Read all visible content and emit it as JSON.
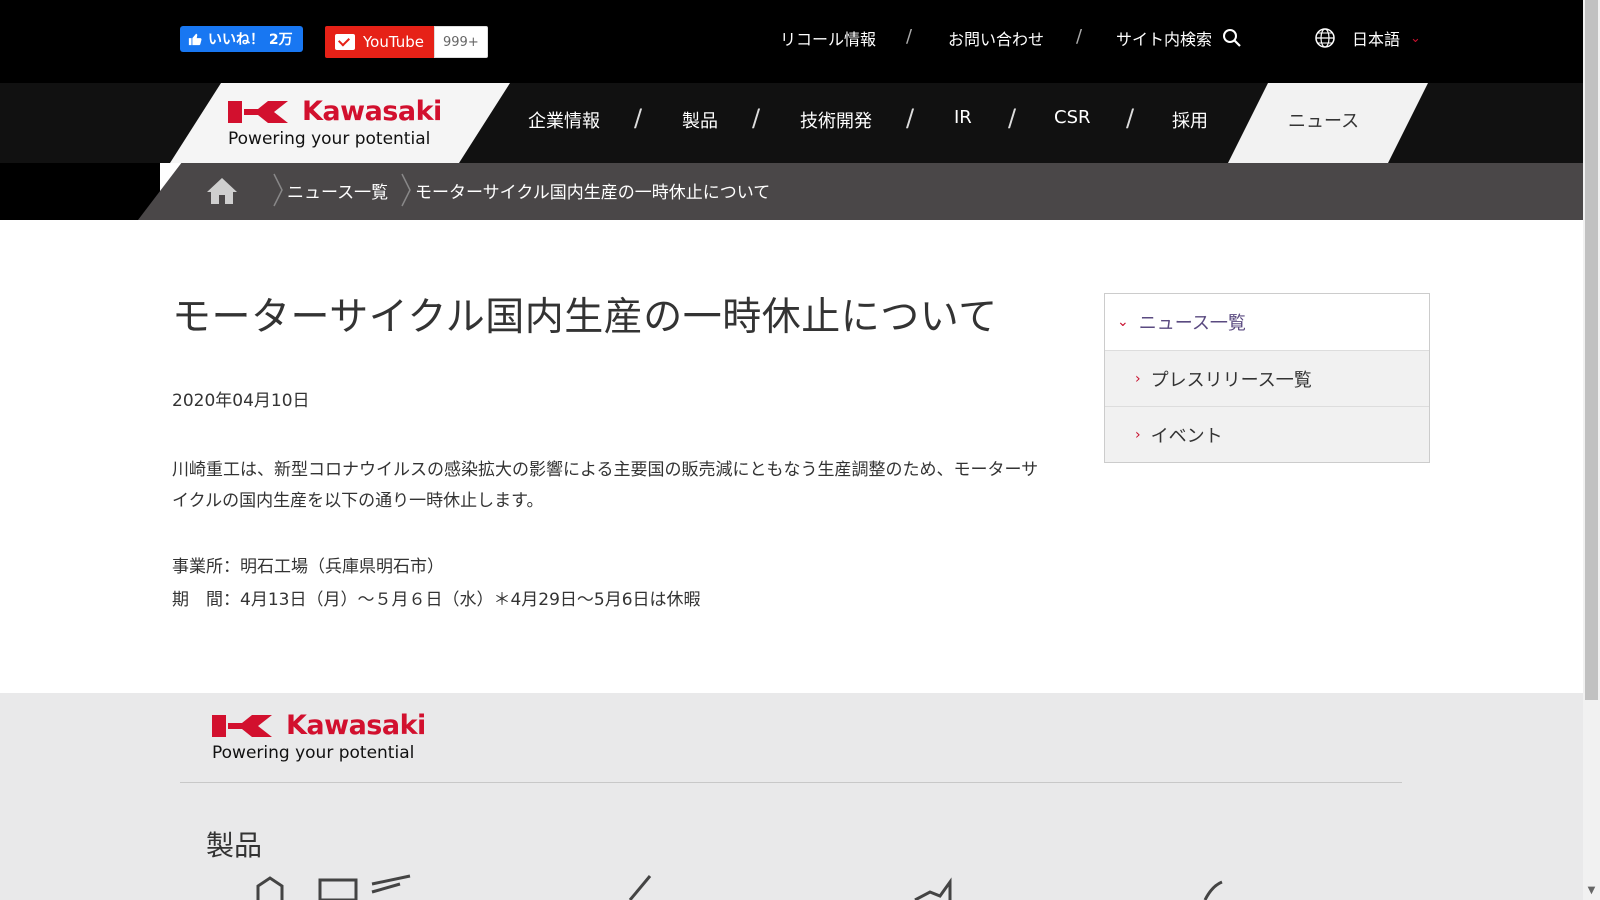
{
  "social": {
    "fb_like": "いいね！ 2万",
    "youtube_label": "YouTube",
    "youtube_count": "999+"
  },
  "utility_nav": {
    "recall": "リコール情報",
    "contact": "お問い合わせ",
    "search": "サイト内検索",
    "language": "日本語"
  },
  "brand": {
    "name": "Kawasaki",
    "tagline": "Powering your potential",
    "color": "#d2102e"
  },
  "main_nav": {
    "items": [
      "企業情報",
      "製品",
      "技術開発",
      "IR",
      "CSR",
      "採用"
    ],
    "active": "ニュース"
  },
  "breadcrumb": {
    "items": [
      "ニュース一覧",
      "モーターサイクル国内生産の一時休止について"
    ]
  },
  "article": {
    "title": "モーターサイクル国内生産の一時休止について",
    "date": "2020年04月10日",
    "body": "川崎重工は、新型コロナウイルスの感染拡大の影響による主要国の販売減にともなう生産調整のため、モーターサイクルの国内生産を以下の通り一時休止します。",
    "facility": "事業所：明石工場（兵庫県明石市）",
    "period": "期　間：4月13日（月）～５月６日（水）＊4月29日～5月6日は休暇"
  },
  "side_menu": {
    "items": [
      "ニュース一覧",
      "プレスリリース一覧",
      "イベント"
    ]
  },
  "footer": {
    "products_heading": "製品"
  }
}
